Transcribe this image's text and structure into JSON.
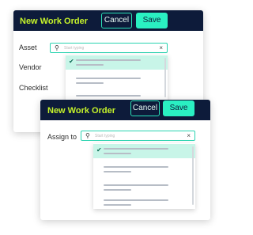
{
  "back_form": {
    "title": "New Work Order",
    "cancel_label": "Cancel",
    "save_label": "Save",
    "fields": [
      {
        "label": "Asset"
      },
      {
        "label": "Vendor"
      },
      {
        "label": "Checklist"
      }
    ],
    "search": {
      "placeholder": "Start typing",
      "clear_icon": "×"
    }
  },
  "front_form": {
    "title": "New Work Order",
    "cancel_label": "Cancel",
    "save_label": "Save",
    "assign_label": "Assign to",
    "search": {
      "placeholder": "Start typing",
      "clear_icon": "×"
    }
  },
  "colors": {
    "header_bg": "#0d1b3a",
    "title": "#c6f32a",
    "accent": "#2af0c2",
    "selected_row": "#c8f5e8"
  }
}
